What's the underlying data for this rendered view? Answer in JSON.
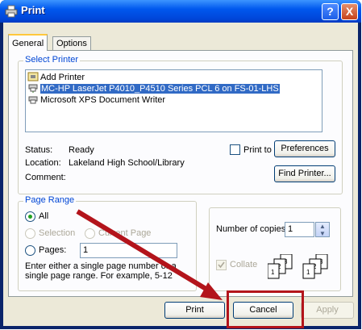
{
  "window": {
    "title": "Print",
    "help_label": "?",
    "close_label": "X"
  },
  "tabs": [
    {
      "label": "General"
    },
    {
      "label": "Options"
    }
  ],
  "select_printer": {
    "group_label": "Select Printer",
    "printers": [
      {
        "label": "Add Printer"
      },
      {
        "label": "MC-HP LaserJet P4010_P4510 Series PCL 6 on FS-01-LHS"
      },
      {
        "label": "Microsoft XPS Document Writer"
      }
    ],
    "status_label": "Status:",
    "status_value": "Ready",
    "location_label": "Location:",
    "location_value": "Lakeland High School/Library",
    "comment_label": "Comment:",
    "print_to_file_label": "Print to file",
    "preferences_label": "Preferences",
    "find_printer_label": "Find Printer..."
  },
  "page_range": {
    "group_label": "Page Range",
    "all_label": "All",
    "selection_label": "Selection",
    "current_page_label": "Current Page",
    "pages_label": "Pages:",
    "pages_value": "1",
    "hint": "Enter either a single page number or a single page range.  For example, 5-12"
  },
  "copies": {
    "number_label": "Number of copies:",
    "number_value": "1",
    "collate_label": "Collate",
    "spin_up": "▲",
    "spin_down": "▼"
  },
  "footer": {
    "print_label": "Print",
    "cancel_label": "Cancel",
    "apply_label": "Apply"
  },
  "colors": {
    "annotation_red": "#b3141b",
    "selection_blue": "#316ac5"
  }
}
